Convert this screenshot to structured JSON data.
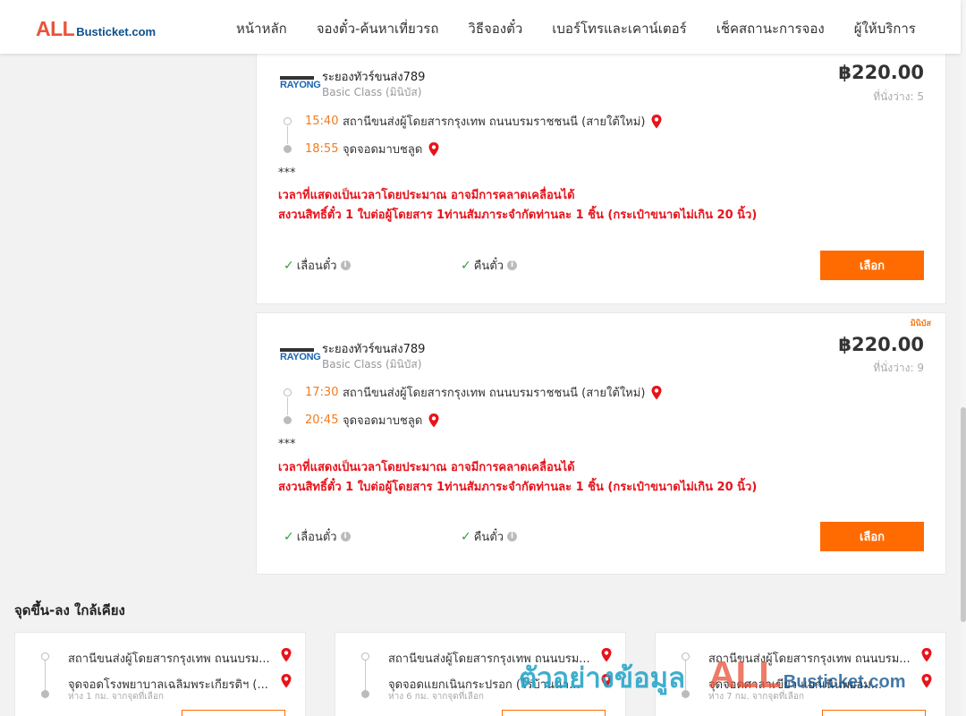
{
  "header": {
    "logo_all": "ALL",
    "logo_rest": "Busticket.com",
    "nav": [
      "หน้าหลัก",
      "จองตั๋ว-ค้นหาเที่ยวรถ",
      "วิธีจองตั๋ว",
      "เบอร์โทรและเคาน์เตอร์",
      "เช็คสถานะการจอง",
      "ผู้ให้บริการ"
    ]
  },
  "trips": [
    {
      "operator_logo": "RAYONG",
      "operator": "ระยองทัวร์ขนส่ง789",
      "class": "Basic Class (มินิบัส)",
      "price": "฿220.00",
      "seats": "ที่นั่งว่าง: 5",
      "badge": "",
      "depart_time": "15:40",
      "depart_place": "สถานีขนส่งผู้โดยสารกรุงเทพ ถนนบรมราชชนนี (สายใต้ใหม่)",
      "arrive_time": "18:55",
      "arrive_place": "จุดจอดมาบชลูด",
      "stars": "***",
      "note1": "เวลาที่แสดงเป็นเวลาโดยประมาณ อาจมีการคลาดเคลื่อนได้",
      "note2": "สงวนสิทธิ์ตั๋ว 1 ใบต่อผู้โดยสาร 1ท่านสัมภาระจำกัดท่านละ 1 ชิ้น (กระเป๋าขนาดไม่เกิน 20 นิ้ว)",
      "feature_postpone": "เลื่อนตั๋ว",
      "feature_refund": "คืนตั๋ว",
      "select_label": "เลือก"
    },
    {
      "operator_logo": "RAYONG",
      "operator": "ระยองทัวร์ขนส่ง789",
      "class": "Basic Class (มินิบัส)",
      "price": "฿220.00",
      "seats": "ที่นั่งว่าง: 9",
      "badge": "มินิบัส",
      "depart_time": "17:30",
      "depart_place": "สถานีขนส่งผู้โดยสารกรุงเทพ ถนนบรมราชชนนี (สายใต้ใหม่)",
      "arrive_time": "20:45",
      "arrive_place": "จุดจอดมาบชลูด",
      "stars": "***",
      "note1": "เวลาที่แสดงเป็นเวลาโดยประมาณ อาจมีการคลาดเคลื่อนได้",
      "note2": "สงวนสิทธิ์ตั๋ว 1 ใบต่อผู้โดยสาร 1ท่านสัมภาระจำกัดท่านละ 1 ชิ้น (กระเป๋าขนาดไม่เกิน 20 นิ้ว)",
      "feature_postpone": "เลื่อนตั๋ว",
      "feature_refund": "คืนตั๋ว",
      "select_label": "เลือก"
    }
  ],
  "nearby": {
    "title": "จุดขึ้น-ลง ใกล้เคียง",
    "items": [
      {
        "from": "สถานีขนส่งผู้โดยสารกรุงเทพ ถนนบรม...",
        "to": "จุดจอดโรงพยาบาลเฉลิมพระเกียรติฯ (...",
        "distance": "ห่าง 1 กม. จากจุดที่เลือก"
      },
      {
        "from": "สถานีขนส่งผู้โดยสารกรุงเทพ ถนนบรม...",
        "to": "จุดจอดแยกเนินกระปรอก (ไร่บ้านนา...",
        "distance": "ห่าง 6 กม. จากจุดที่เลือก"
      },
      {
        "from": "สถานีขนส่งผู้โดยสารกรุงเทพ ถนนบรม...",
        "to": "จุดจอดศาลาเขียว แยกเนินพยอม...",
        "distance": "ห่าง 7 กม. จากจุดที่เลือก"
      }
    ]
  },
  "watermark": {
    "text_th": "ตัวอย่างข้อมูล",
    "all": "ALL",
    "rest": "Busticket.com"
  },
  "colors": {
    "accent": "#ff6b00",
    "time": "#f47b20",
    "warning": "#e8131b",
    "brand_red": "#e8543a",
    "brand_blue": "#0d4f8b"
  },
  "icons": [
    "map-pin-icon",
    "check-icon",
    "info-icon"
  ]
}
